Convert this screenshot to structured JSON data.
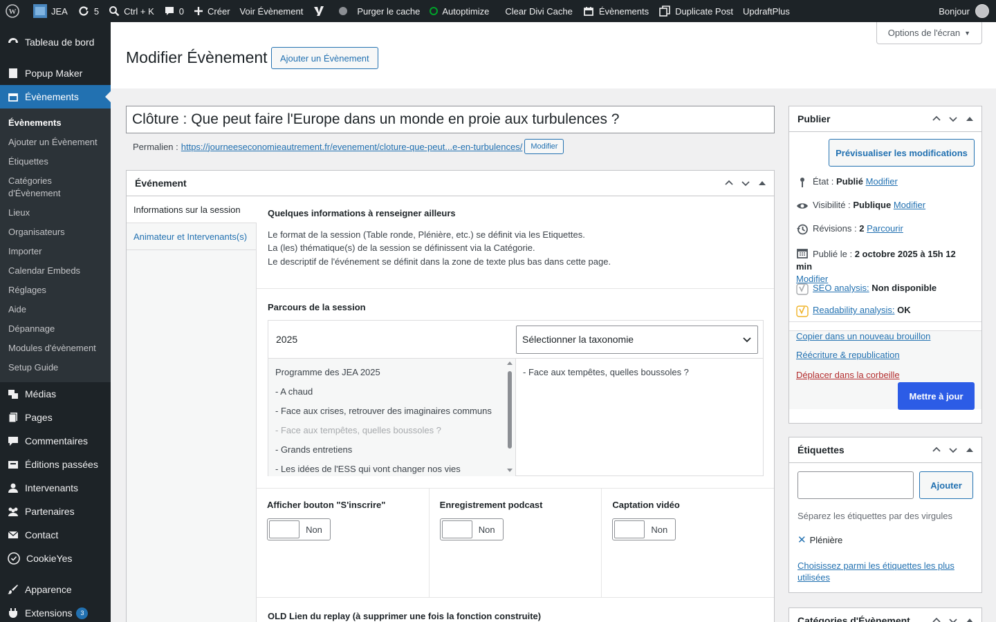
{
  "adminbar": {
    "site": "JEA",
    "updates": "5",
    "shortcut": "Ctrl + K",
    "comments": "0",
    "new": "Créer",
    "view": "Voir Évènement",
    "purge": "Purger le cache",
    "autoptimize": "Autoptimize",
    "divi": "Clear Divi Cache",
    "events": "Évènements",
    "duplicate": "Duplicate Post",
    "updraft": "UpdraftPlus",
    "greeting": "Bonjour",
    "accent": "#00a32a"
  },
  "sidebar": {
    "dashboard": "Tableau de bord",
    "popup": "Popup Maker",
    "events": "Évènements",
    "submenu": [
      "Évènements",
      "Ajouter un Évènement",
      "Étiquettes",
      "Catégories d'Évènement",
      "Lieux",
      "Organisateurs",
      "Importer",
      "Calendar Embeds",
      "Réglages",
      "Aide",
      "Dépannage",
      "Modules d'évènement",
      "Setup Guide"
    ],
    "media": "Médias",
    "pages": "Pages",
    "comments": "Commentaires",
    "past": "Éditions passées",
    "speakers": "Intervenants",
    "partners": "Partenaires",
    "contact": "Contact",
    "cookie": "CookieYes",
    "appearance": "Apparence",
    "plugins": "Extensions",
    "plugins_count": "3"
  },
  "header": {
    "screen_options": "Options de l'écran",
    "title": "Modifier Évènement",
    "add_new": "Ajouter un Évènement"
  },
  "post": {
    "title": "Clôture : Que peut faire l'Europe dans un monde en proie aux turbulences ?",
    "permalink_label": "Permalien :",
    "permalink_url": "https://journeeseconomieautrement.fr/evenement/cloture-que-peut...e-en-turbulences/",
    "permalink_edit": "Modifier"
  },
  "event_box": {
    "title": "Événement",
    "tabs": [
      "Informations sur la session",
      "Animateur et Intervenants(s)"
    ],
    "info_title": "Quelques informations à renseigner ailleurs",
    "info_lines": [
      "Le format de la session (Table ronde, Plénière, etc.) se définit via les Etiquettes.",
      "La (les) thématique(s) de la session se définissent via la Catégorie.",
      "Le descriptif de l'événement se définit dans la zone de texte plus bas dans cette page."
    ],
    "parcours_label": "Parcours de la session",
    "year": "2025",
    "select_placeholder": "Sélectionner la taxonomie",
    "options": [
      "Programme des JEA 2025",
      "- A chaud",
      "- Face aux crises, retrouver des imaginaires communs",
      "- Face aux tempêtes, quelles boussoles ?",
      "- Grands entretiens",
      "- Les idées de l'ESS qui vont changer nos vies"
    ],
    "selected": [
      "- Face aux tempêtes, quelles boussoles ?"
    ],
    "toggles": [
      {
        "label": "Afficher bouton \"S'inscrire\"",
        "state": "Non"
      },
      {
        "label": "Enregistrement podcast",
        "state": "Non"
      },
      {
        "label": "Captation vidéo",
        "state": "Non"
      }
    ],
    "old_replay": "OLD Lien du replay (à supprimer une fois la fonction construite)"
  },
  "publish": {
    "title": "Publier",
    "preview": "Prévisualiser les modifications",
    "status_label": "État :",
    "status_value": "Publié",
    "visibility_label": "Visibilité :",
    "visibility_value": "Publique",
    "edit": "Modifier",
    "revisions_label": "Révisions :",
    "revisions_value": "2",
    "browse": "Parcourir",
    "published_label": "Publié le :",
    "published_value": "2 octobre 2025 à 15h 12 min",
    "seo_link": "SEO analysis:",
    "seo_value": "Non disponible",
    "read_link": "Readability analysis:",
    "read_value": "OK",
    "copy_draft": "Copier dans un nouveau brouillon",
    "rewrite": "Réécriture & republication",
    "trash": "Déplacer dans la corbeille",
    "update": "Mettre à jour"
  },
  "tags": {
    "title": "Étiquettes",
    "input_value": "",
    "add": "Ajouter",
    "hint": "Séparez les étiquettes par des virgules",
    "tag": "Plénière",
    "choose": "Choisissez parmi les étiquettes les plus utilisées"
  },
  "categories": {
    "title": "Catégories d'Évènement"
  }
}
